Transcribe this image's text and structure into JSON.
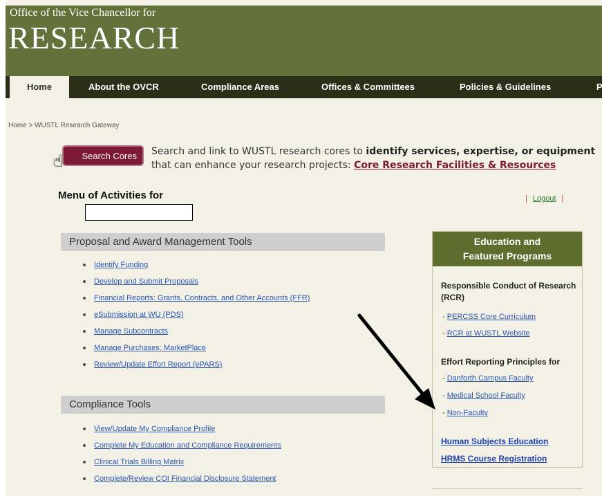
{
  "header": {
    "office_line": "Office of the Vice Chancellor for",
    "research_line": "RESEARCH",
    "brand_color": "#63713a"
  },
  "nav": {
    "items": [
      {
        "label": "Home"
      },
      {
        "label": "About the OVCR"
      },
      {
        "label": "Compliance Areas"
      },
      {
        "label": "Offices & Committees"
      },
      {
        "label": "Policies & Guidelines"
      },
      {
        "label": "P"
      }
    ],
    "active": "Home",
    "bar_color": "#2b2f17"
  },
  "breadcrumb": "Home > WUSTL Research Gateway",
  "search": {
    "button_label": "Search Cores",
    "text_prefix": "Search and link to WUSTL research cores to ",
    "text_bold": "identify services, expertise, or equipment",
    "text_suffix": "that can enhance your research projects: ",
    "link": "Core Research Facilities & Resources",
    "button_color": "#7d1a36"
  },
  "menu": {
    "title": "Menu of Activities for",
    "logout": "Logout"
  },
  "proposal_tools": {
    "title": "Proposal and Award Management Tools",
    "items": [
      "Identify Funding",
      "Develop and Submit Proposals",
      "Financial Reports: Grants, Contracts, and Other Accounts (FFR)",
      "eSubmission at WU (PDS)",
      "Manage Subcontracts",
      "Manage Purchases: MarketPlace",
      "Review/Update Effort Report (ePARS)"
    ]
  },
  "compliance_tools": {
    "title": "Compliance Tools",
    "items": [
      "View/Update My Compliance Profile",
      "Complete My Education and Compliance Requirements",
      "Clinical Trials Billing Matrix",
      "Complete/Review COI Financial Disclosure Statement"
    ]
  },
  "education": {
    "header_line1": "Education and",
    "header_line2": "Featured Programs",
    "rcr_heading": "Responsible Conduct of Research (RCR)",
    "rcr_links": [
      "PERCSS Core Curriculum",
      "RCR at WUSTL Website"
    ],
    "effort_heading": "Effort Reporting Principles for",
    "effort_links": [
      "Danforth Campus Faculty",
      "Medical School Faculty",
      "Non-Faculty"
    ],
    "human_subjects": "Human Subjects Education",
    "hrms": "HRMS Course Registration"
  }
}
